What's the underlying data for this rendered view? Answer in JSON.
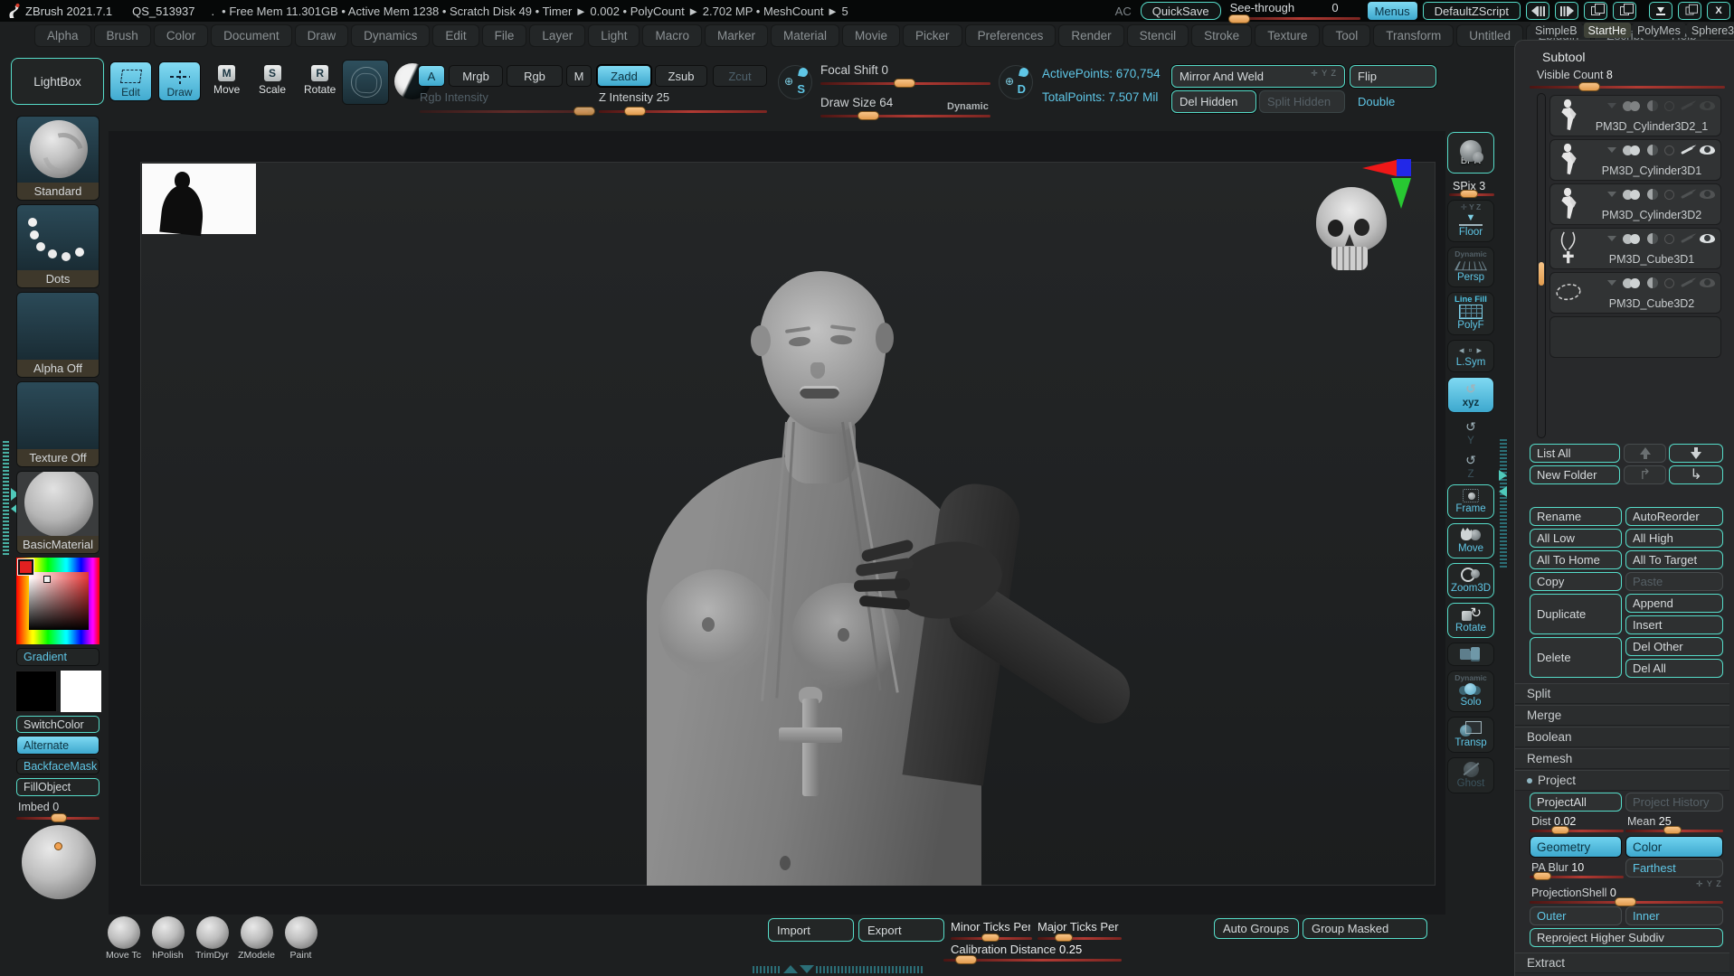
{
  "titlebar": {
    "app": "ZBrush 2021.7.1",
    "doc": "QS_513937",
    "dot": ".",
    "stats": "• Free Mem 11.301GB • Active Mem 1238 • Scratch Disk 49 •  Timer ► 0.002 • PolyCount ► 2.702 MP • MeshCount ► 5",
    "ac": "AC",
    "quicksave": "QuickSave",
    "seethrough_label": "See-through",
    "seethrough_value": "0",
    "menus": "Menus",
    "zscript": "DefaultZScript"
  },
  "menubar": {
    "items": [
      "Alpha",
      "Brush",
      "Color",
      "Document",
      "Draw",
      "Dynamics",
      "Edit",
      "File",
      "Layer",
      "Light",
      "Macro",
      "Marker",
      "Material",
      "Movie",
      "Picker",
      "Preferences",
      "Render",
      "Stencil",
      "Stroke",
      "Texture",
      "Tool",
      "Transform",
      "Untitled",
      "Zplugin",
      "Zscript",
      "Help"
    ]
  },
  "tool_tabs": [
    {
      "label": "SimpleB",
      "name": "tab-simplebrush"
    },
    {
      "label": "StartHe",
      "active": true,
      "name": "tab-starthead"
    },
    {
      "label": "PolyMes",
      "name": "tab-polymesh"
    },
    {
      "label": "Sphere3",
      "name": "tab-sphere3d"
    }
  ],
  "toolbar": {
    "lightbox": "LightBox",
    "edit": "Edit",
    "draw": "Draw",
    "move": "Move",
    "scale": "Scale",
    "rotate": "Rotate",
    "move_letter": "M",
    "scale_letter": "S",
    "rotate_letter": "R",
    "a": "A",
    "mrgb": "Mrgb",
    "rgb": "Rgb",
    "m": "M",
    "zadd": "Zadd",
    "zsub": "Zsub",
    "zcut": "Zcut",
    "rgb_intensity": "Rgb Intensity",
    "z_intensity": "Z Intensity",
    "z_intensity_value": "25",
    "focal_shift": "Focal Shift",
    "focal_shift_value": "0",
    "draw_size": "Draw Size",
    "draw_size_value": "64",
    "dynamic": "Dynamic",
    "s_badge": "S",
    "d_badge": "D",
    "active_points": "ActivePoints: 670,754",
    "total_points": "TotalPoints: 7.507 Mil",
    "mirror_weld": "Mirror And Weld",
    "flip": "Flip",
    "del_hidden": "Del Hidden",
    "split_hidden": "Split Hidden",
    "double": "Double",
    "axis_mini": "✛ Y Z"
  },
  "left_tray": {
    "brush_label": "Standard",
    "stroke_label": "Dots",
    "alpha_label": "Alpha Off",
    "texture_label": "Texture Off",
    "material_label": "BasicMaterial",
    "gradient": "Gradient",
    "switch_color": "SwitchColor",
    "alternate": "Alternate",
    "backface_mask": "BackfaceMask",
    "fill_object": "FillObject",
    "imbed_label": "Imbed",
    "imbed_value": "0"
  },
  "right_strip": {
    "bpr": "BPR",
    "spix_label": "SPix",
    "spix_value": "3",
    "items": [
      {
        "name": "floor-button",
        "icon_name": "floor-icon",
        "icon": "ic-floor",
        "top": "✛ Y Z",
        "label": "Floor"
      },
      {
        "name": "persp-button",
        "icon_name": "perspective-icon",
        "icon": "ic-persp",
        "top": "Dynamic",
        "label": "Persp"
      },
      {
        "name": "polyframe-button",
        "icon_name": "polyframe-grid-icon",
        "icon": "ic-grid",
        "top": "Line Fill",
        "top_bright": true,
        "label": "PolyF"
      },
      {
        "name": "local-symmetry-button",
        "icon_name": "local-symmetry-icon",
        "icon": "ic-lsym",
        "label": "L.Sym"
      },
      {
        "name": "rotate-xyz-button",
        "icon_name": "rotate-xyz-icon",
        "icon": "ic-rot",
        "label": "xyz",
        "active": true,
        "small": true
      },
      {
        "name": "rotate-y-button",
        "icon_name": "rotate-y-icon",
        "icon": "ic-rot",
        "label": "Y",
        "plain": true,
        "dim": true,
        "small": true
      },
      {
        "name": "rotate-z-button",
        "icon_name": "rotate-z-icon",
        "icon": "ic-rot",
        "label": "Z",
        "plain": true,
        "dim": true,
        "small": true
      },
      {
        "name": "frame-button",
        "icon_name": "frame-icon",
        "icon": "ic-frame",
        "label": "Frame",
        "outline": true
      },
      {
        "name": "move-3d-button",
        "icon_name": "move-hand-icon",
        "icon": "ic-move",
        "label": "Move",
        "outline": true
      },
      {
        "name": "zoom3d-button",
        "icon_name": "zoom-magnifier-icon",
        "icon": "ic-zoom",
        "label": "Zoom3D",
        "outline": true
      },
      {
        "name": "rotate-3d-button",
        "icon_name": "rotate-cube-icon",
        "icon": "ic-rotate3d",
        "label": "Rotate",
        "outline": true
      },
      {
        "name": "camera-lock-button",
        "icon_name": "camera-lock-icon",
        "icon": "ic-cam",
        "label": ""
      },
      {
        "name": "solo-button",
        "icon_name": "solo-spheres-icon",
        "icon": "ic-solo",
        "top": "Dynamic",
        "label": "Solo"
      },
      {
        "name": "transparency-button",
        "icon_name": "transparency-icon",
        "icon": "ic-transp",
        "label": "Transp"
      },
      {
        "name": "ghost-button",
        "icon_name": "ghost-icon",
        "icon": "ic-ghost",
        "label": "Ghost",
        "dim": true
      }
    ]
  },
  "subtool": {
    "title": "Subtool",
    "visible_count_label": "Visible Count",
    "visible_count_value": "8",
    "rows": [
      {
        "name": "PM3D_Cylinder3D2_1",
        "t_figure": true,
        "eye_dim": true,
        "brush_dim": true,
        "all_dim": true
      },
      {
        "name": "PM3D_Cylinder3D1",
        "t_figure": true
      },
      {
        "name": "PM3D_Cylinder3D2",
        "t_figure": true,
        "eye_dim": true,
        "brush_dim": true
      },
      {
        "name": "PM3D_Cube3D1",
        "t_necklace": true,
        "brush_dim": true
      },
      {
        "name": "PM3D_Cube3D2",
        "t_loop": true,
        "eye_dim": true,
        "brush_dim": true
      },
      {
        "empty": true
      }
    ],
    "buttons": {
      "list_all": "List All",
      "new_folder": "New Folder",
      "rename": "Rename",
      "autoreorder": "AutoReorder",
      "all_low": "All Low",
      "all_high": "All High",
      "all_to_home": "All To Home",
      "all_to_target": "All To Target",
      "copy": "Copy",
      "paste": "Paste",
      "duplicate": "Duplicate",
      "append": "Append",
      "insert": "Insert",
      "delete": "Delete",
      "del_other": "Del Other",
      "del_all": "Del All"
    },
    "sections": {
      "split": "Split",
      "merge": "Merge",
      "boolean": "Boolean",
      "remesh": "Remesh",
      "project": "Project",
      "extract": "Extract"
    },
    "project": {
      "project_all": "ProjectAll",
      "history": "Project History",
      "dist_label": "Dist",
      "dist_value": "0.02",
      "mean_label": "Mean",
      "mean_value": "25",
      "geometry": "Geometry",
      "color": "Color",
      "pa_blur_label": "PA Blur",
      "pa_blur_value": "10",
      "farthest": "Farthest",
      "shell_label": "ProjectionShell",
      "shell_value": "0",
      "outer": "Outer",
      "inner": "Inner",
      "reproject": "Reproject Higher Subdiv",
      "axis_mini": "✛ Y Z"
    }
  },
  "bottom": {
    "brushes": [
      {
        "label": "Move Tc"
      },
      {
        "label": "hPolish"
      },
      {
        "label": "TrimDyr"
      },
      {
        "label": "ZModele"
      },
      {
        "label": "Paint"
      }
    ],
    "import": "Import",
    "export": "Export",
    "minor_ticks": "Minor Ticks Per U",
    "major_ticks": "Major Ticks Per U",
    "calibration": "Calibration Distance",
    "calibration_value": "0.25",
    "auto_groups": "Auto Groups",
    "group_masked": "Group Masked"
  }
}
